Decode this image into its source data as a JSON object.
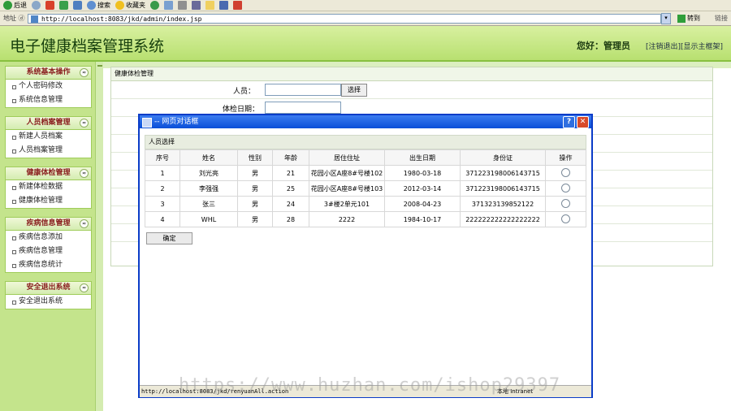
{
  "browser": {
    "toolbar": {
      "back": "后退",
      "search": "搜索",
      "favorites": "收藏夹"
    },
    "address_label": "地址 ⓓ",
    "url": "http://localhost:8083/jkd/admin/index.jsp",
    "go_label": "转到",
    "links_label": "链接"
  },
  "header": {
    "title": "电子健康档案管理系统",
    "greeting": "您好：管理员",
    "logout": "[注销退出]",
    "main_frame": "[显示主框架]"
  },
  "sidebar": {
    "groups": [
      {
        "title": "系统基本操作",
        "items": [
          "个人密码修改",
          "系统信息管理"
        ]
      },
      {
        "title": "人员档案管理",
        "items": [
          "新建人员档案",
          "人员档案管理"
        ]
      },
      {
        "title": "健康体检管理",
        "items": [
          "新建体检数据",
          "健康体检管理"
        ]
      },
      {
        "title": "疾病信息管理",
        "items": [
          "疾病信息添加",
          "疾病信息管理",
          "疾病信息统计"
        ]
      },
      {
        "title": "安全退出系统",
        "items": [
          "安全退出系统"
        ]
      }
    ]
  },
  "form": {
    "title": "健康体检管理",
    "person_label": "人员：",
    "select_button": "选择",
    "date_label": "体检日期："
  },
  "dialog": {
    "title": "-- 网页对话框",
    "section_title": "人员选择",
    "columns": [
      "序号",
      "姓名",
      "性别",
      "年龄",
      "居住住址",
      "出生日期",
      "身份证",
      "操作"
    ],
    "rows": [
      [
        "1",
        "刘光亮",
        "男",
        "21",
        "花园小区A座8#号楼102",
        "1980-03-18",
        "371223198006143715"
      ],
      [
        "2",
        "李强强",
        "男",
        "25",
        "花园小区A座8#号楼103",
        "2012-03-14",
        "371223198006143715"
      ],
      [
        "3",
        "张三",
        "男",
        "24",
        "3#楼2单元101",
        "2008-04-23",
        "371323139852122"
      ],
      [
        "4",
        "WHL",
        "男",
        "28",
        "2222",
        "1984-10-17",
        "222222222222222222"
      ]
    ],
    "ok_button": "确定",
    "status_url": "http://localhost:8083/jkd/renyuanAll.action",
    "status_zone": "本地 Intranet"
  },
  "watermark": "https://www.huzhan.com/ishop29397"
}
